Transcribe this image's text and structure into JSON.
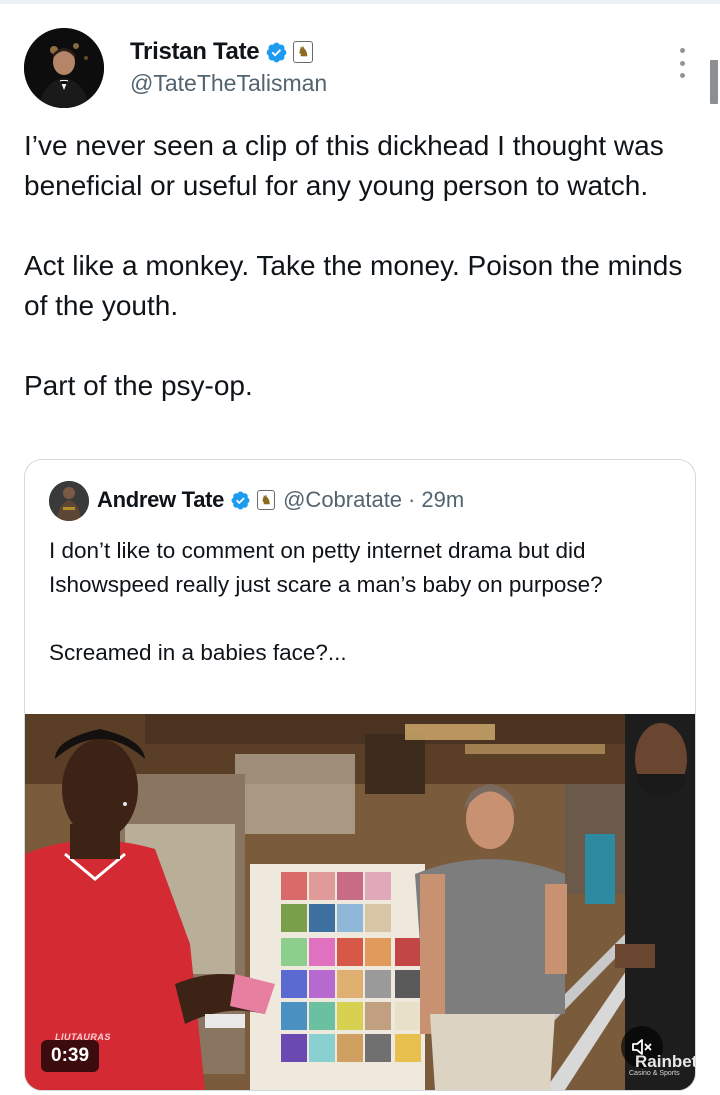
{
  "tweet": {
    "author": {
      "display_name": "Tristan Tate",
      "handle": "@TateTheTalisman",
      "verified_color": "#1d9bf0"
    },
    "paragraphs": [
      "I’ve never seen a clip of this dickhead I thought was beneficial or useful for any young person to watch.",
      "Act like a monkey. Take the money. Poison the minds of the youth.",
      "Part of the psy-op."
    ],
    "more_icon": "more-horizontal-icon"
  },
  "quoted_tweet": {
    "author": {
      "display_name": "Andrew Tate",
      "handle": "@Cobratate",
      "separator": "·",
      "time": "29m"
    },
    "paragraphs": [
      "I don’t like to comment on petty internet drama but did Ishowspeed really just scare a man’s baby on purpose?",
      "Screamed in a babies face?..."
    ],
    "video": {
      "duration": "0:39",
      "watermark_left": "LIUTAURAS",
      "watermark_right": "Rainbet",
      "watermark_right_sub": "Casino & Sports",
      "muted_icon": "volume-muted-icon"
    }
  }
}
